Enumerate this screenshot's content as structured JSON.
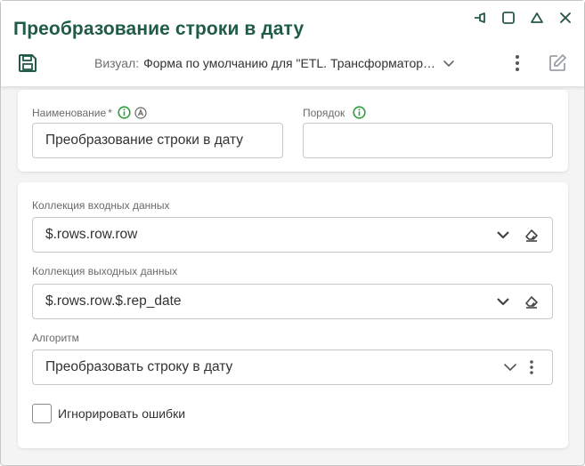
{
  "window": {
    "title": "Преобразование строки в дату",
    "icons": [
      "pin-icon",
      "maximize-icon",
      "collapse-icon",
      "close-icon"
    ]
  },
  "toolbar": {
    "save_icon": "save-icon",
    "visual_label": "Визуал:",
    "visual_value": "Форма по умолчанию для \"ETL. Трансформатор…",
    "more_icon": "kebab-icon",
    "edit_icon": "edit-icon"
  },
  "form": {
    "name": {
      "label": "Наименование",
      "required_mark": "*",
      "value": "Преобразование строки в дату"
    },
    "order": {
      "label": "Порядок",
      "value": ""
    },
    "input_collection": {
      "label": "Коллекция входных данных",
      "value": "$.rows.row.row"
    },
    "output_collection": {
      "label": "Коллекция выходных данных",
      "value": "$.rows.row.$.rep_date"
    },
    "algorithm": {
      "label": "Алгоритм",
      "value": "Преобразовать строку в дату"
    },
    "ignore_errors": {
      "label": "Игнорировать ошибки",
      "checked": false
    }
  },
  "colors": {
    "title": "#1f5b45",
    "accent_green": "#2e9e3a",
    "icon_gray": "#4a4a4a"
  }
}
